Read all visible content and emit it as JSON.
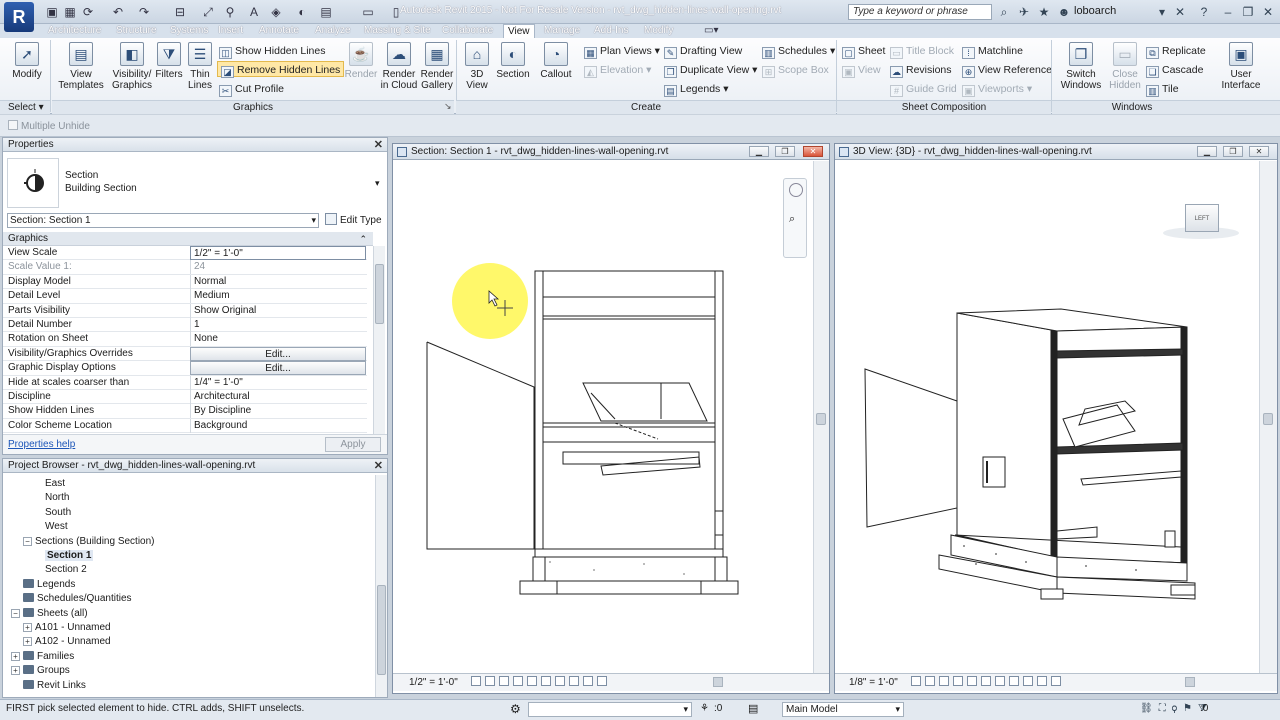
{
  "app": {
    "menu_letter": "R",
    "window_title": "Autodesk Revit 2015 - Not For Resale Version -   rvt_dwg_hidden-lines-wall-opening.rvt",
    "search_placeholder": "Type a keyword or phrase",
    "user": "loboarch"
  },
  "tabs": [
    "Architecture",
    "Structure",
    "Systems",
    "Insert",
    "Annotate",
    "Analyze",
    "Massing & Site",
    "Collaborate",
    "View",
    "Manage",
    "Add-Ins",
    "Modify"
  ],
  "active_tab": "View",
  "ribbon": {
    "modify": "Modify",
    "select": "Select",
    "graphics": {
      "title": "Graphics",
      "view_templates": "View Templates",
      "visibility_graphics": "Visibility/ Graphics",
      "filters": "Filters",
      "thin_lines": "Thin Lines",
      "show_hidden_lines": "Show  Hidden Lines",
      "remove_hidden_lines": "Remove  Hidden Lines",
      "cut_profile": "Cut  Profile"
    },
    "presentation": {
      "render": "Render",
      "render_in_cloud": "Render in Cloud",
      "render_gallery": "Render Gallery"
    },
    "create": {
      "title": "Create",
      "view_3d": "3D View",
      "section": "Section",
      "callout": "Callout",
      "plan_views": "Plan  Views",
      "elevation": "Elevation",
      "drafting_view": "Drafting  View",
      "duplicate_view": "Duplicate  View",
      "legends": "Legends",
      "schedules": "Schedules",
      "scope_box": "Scope  Box"
    },
    "sheet_composition": {
      "title": "Sheet Composition",
      "sheet": "Sheet",
      "view": "View",
      "title_block": "Title  Block",
      "revisions": "Revisions",
      "guide_grid": "Guide  Grid",
      "matchline": "Matchline",
      "view_reference": "View  Reference",
      "viewports": "Viewports"
    },
    "windows": {
      "title": "Windows",
      "switch_windows": "Switch Windows",
      "close_hidden": "Close Hidden",
      "replicate": "Replicate",
      "cascade": "Cascade",
      "tile": "Tile",
      "user_interface": "User Interface"
    }
  },
  "options_bar": {
    "multiple_unhide": "Multiple Unhide"
  },
  "properties": {
    "title": "Properties",
    "type_name": "Section",
    "type_sub": "Building Section",
    "instance_selector": "Section: Section 1",
    "edit_type": "Edit Type",
    "group_title": "Graphics",
    "rows": [
      {
        "k": "View Scale",
        "v": "1/2\" = 1'-0\""
      },
      {
        "k": "Scale Value    1:",
        "v": "24"
      },
      {
        "k": "Display Model",
        "v": "Normal"
      },
      {
        "k": "Detail Level",
        "v": "Medium"
      },
      {
        "k": "Parts Visibility",
        "v": "Show Original"
      },
      {
        "k": "Detail Number",
        "v": "1"
      },
      {
        "k": "Rotation on Sheet",
        "v": "None"
      },
      {
        "k": "Visibility/Graphics Overrides",
        "v": "Edit..."
      },
      {
        "k": "Graphic Display Options",
        "v": "Edit..."
      },
      {
        "k": "Hide at scales coarser than",
        "v": "1/4\" = 1'-0\""
      },
      {
        "k": "Discipline",
        "v": "Architectural"
      },
      {
        "k": "Show Hidden Lines",
        "v": "By Discipline"
      },
      {
        "k": "Color Scheme Location",
        "v": "Background"
      }
    ],
    "help": "Properties help",
    "apply": "Apply"
  },
  "project_browser": {
    "title": "Project Browser - rvt_dwg_hidden-lines-wall-opening.rvt",
    "items": [
      {
        "label": "East",
        "level": 3,
        "toggle": ""
      },
      {
        "label": "North",
        "level": 3,
        "toggle": ""
      },
      {
        "label": "South",
        "level": 3,
        "toggle": ""
      },
      {
        "label": "West",
        "level": 3,
        "toggle": ""
      },
      {
        "label": "Sections (Building Section)",
        "level": 2,
        "toggle": "−"
      },
      {
        "label": "Section 1",
        "level": 3,
        "toggle": "",
        "selected": true
      },
      {
        "label": "Section 2",
        "level": 3,
        "toggle": ""
      },
      {
        "label": "Legends",
        "level": 1,
        "toggle": ""
      },
      {
        "label": "Schedules/Quantities",
        "level": 1,
        "toggle": ""
      },
      {
        "label": "Sheets (all)",
        "level": 1,
        "toggle": "−"
      },
      {
        "label": "A101 - Unnamed",
        "level": 2,
        "toggle": "+"
      },
      {
        "label": "A102 - Unnamed",
        "level": 2,
        "toggle": "+"
      },
      {
        "label": "Families",
        "level": 1,
        "toggle": "+"
      },
      {
        "label": "Groups",
        "level": 1,
        "toggle": "+"
      },
      {
        "label": "Revit Links",
        "level": 1,
        "toggle": ""
      }
    ]
  },
  "section_view": {
    "title": "Section: Section 1 - rvt_dwg_hidden-lines-wall-opening.rvt",
    "scale": "1/2\" = 1'-0\""
  },
  "view_3d": {
    "title": "3D View: {3D} - rvt_dwg_hidden-lines-wall-opening.rvt",
    "scale": "1/8\" = 1'-0\"",
    "viewcube_face": "LEFT"
  },
  "status": {
    "text": "FIRST pick selected element to hide. CTRL adds, SHIFT unselects.",
    "zero": ":0",
    "model": "Main Model"
  }
}
